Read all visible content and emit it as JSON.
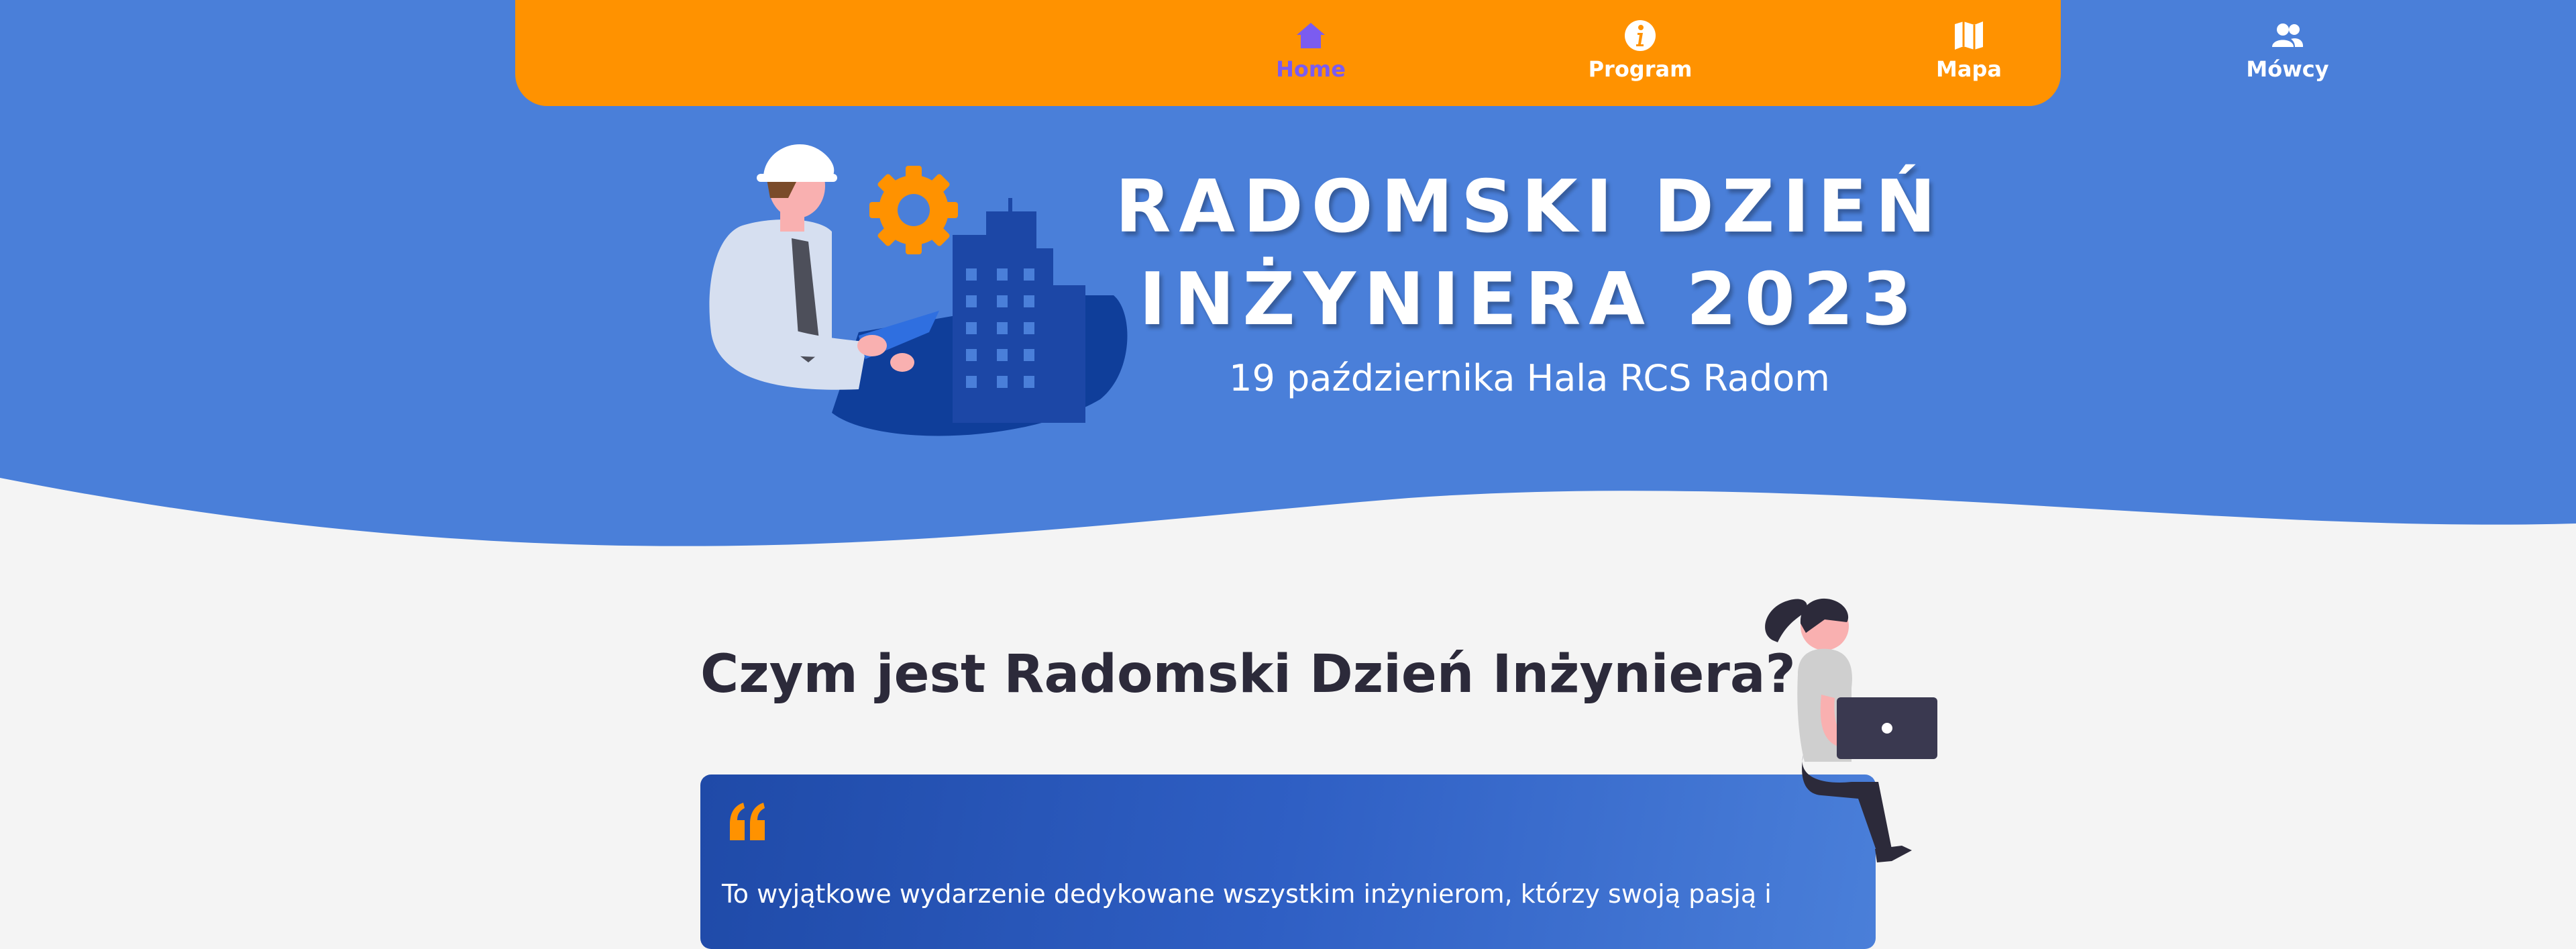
{
  "nav": {
    "items": [
      {
        "label": "Home",
        "icon": "home-icon",
        "active": true
      },
      {
        "label": "Program",
        "icon": "info-icon",
        "active": false
      },
      {
        "label": "Mapa",
        "icon": "map-icon",
        "active": false
      },
      {
        "label": "Mówcy",
        "icon": "users-icon",
        "active": false
      }
    ]
  },
  "hero": {
    "title_line1": "RADOMSKI DZIEŃ",
    "title_line2": "INŻYNIERA 2023",
    "subtitle": "19 października Hala RCS Radom"
  },
  "about": {
    "heading": "Czym jest Radomski Dzień Inżyniera?",
    "quote_text": "To wyjątkowe wydarzenie dedykowane wszystkim inżynierom, którzy swoją pasją i"
  },
  "colors": {
    "hero_blue": "#4a7fd9",
    "nav_orange": "#ff9200",
    "active_purple": "#7b5cf0",
    "page_bg": "#f4f4f4",
    "heading_dark": "#2c2a3a"
  }
}
